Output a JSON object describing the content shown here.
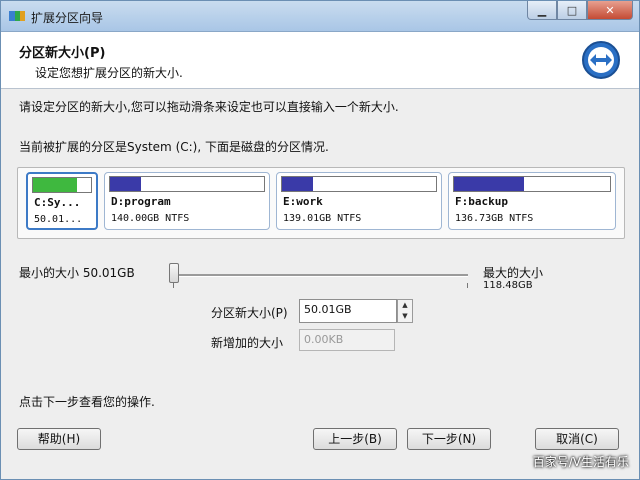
{
  "window": {
    "title": "扩展分区向导"
  },
  "header": {
    "title": "分区新大小(P)",
    "subtitle": "设定您想扩展分区的新大小."
  },
  "intro": "请设定分区的新大小,您可以拖动滑条来设定也可以直接输入一个新大小.",
  "current": "当前被扩展的分区是System (C:), 下面是磁盘的分区情况.",
  "partitions": [
    {
      "name": "C:Sy...",
      "size": "50.01...",
      "fill_fraction": 0.75,
      "color": "#3fb83f"
    },
    {
      "name": "D:program",
      "size": "140.00GB NTFS",
      "fill_fraction": 0.2,
      "color": "#3a3aa8"
    },
    {
      "name": "E:work",
      "size": "139.01GB NTFS",
      "fill_fraction": 0.2,
      "color": "#3a3aa8"
    },
    {
      "name": "F:backup",
      "size": "136.73GB NTFS",
      "fill_fraction": 0.45,
      "color": "#3a3aa8"
    }
  ],
  "slider": {
    "min_label": "最小的大小 50.01GB",
    "max_label": "最大的大小",
    "max_value": "118.48GB"
  },
  "fields": {
    "new_size_label": "分区新大小(P)",
    "new_size_value": "50.01GB",
    "added_label": "新增加的大小",
    "added_value": "0.00KB"
  },
  "footer_hint": "点击下一步查看您的操作.",
  "buttons": {
    "help": "帮助(H)",
    "back": "上一步(B)",
    "next": "下一步(N)",
    "cancel": "取消(C)"
  },
  "watermark": "百家号/V生活有乐"
}
